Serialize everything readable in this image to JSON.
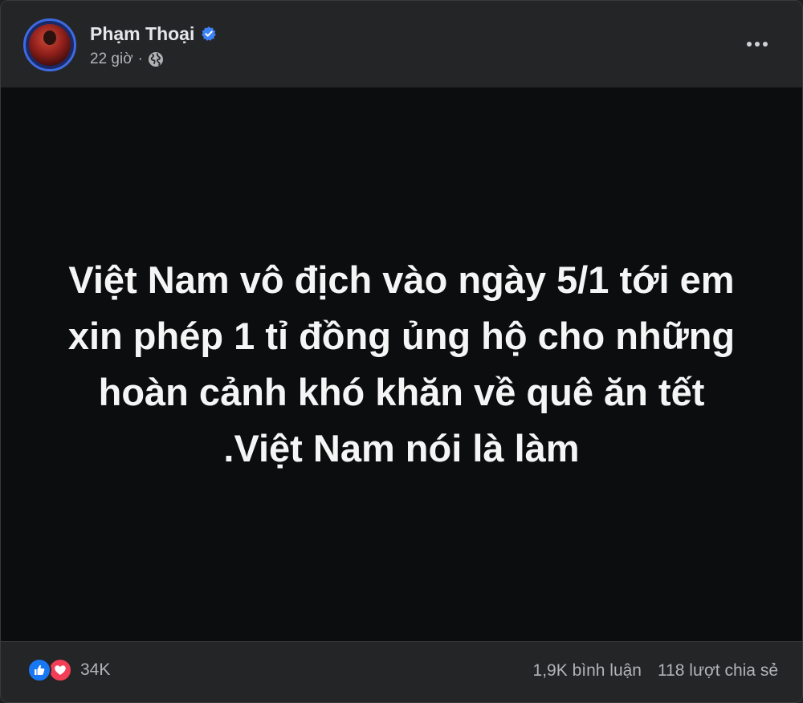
{
  "post": {
    "author_name": "Phạm Thoại",
    "timestamp": "22 giờ",
    "separator": "·",
    "privacy_icon": "globe-icon",
    "verified_icon": "verified-badge-icon",
    "more_icon": "more-options-icon",
    "text": "Việt Nam vô địch vào ngày 5/1 tới em\nxin phép 1 tỉ đồng ủng hộ cho những\nhoàn cảnh khó khăn về quê ăn tết\n.Việt Nam nói là làm"
  },
  "footer": {
    "reaction_icons": [
      "like-icon",
      "love-icon"
    ],
    "reaction_count": "34K",
    "comments": "1,9K bình luận",
    "shares": "118 lượt chia sẻ"
  },
  "colors": {
    "card_bg": "#242526",
    "post_bg": "#0c0d0f",
    "like": "#1877f2",
    "love": "#f33e58",
    "verified": "#3e82f7"
  }
}
